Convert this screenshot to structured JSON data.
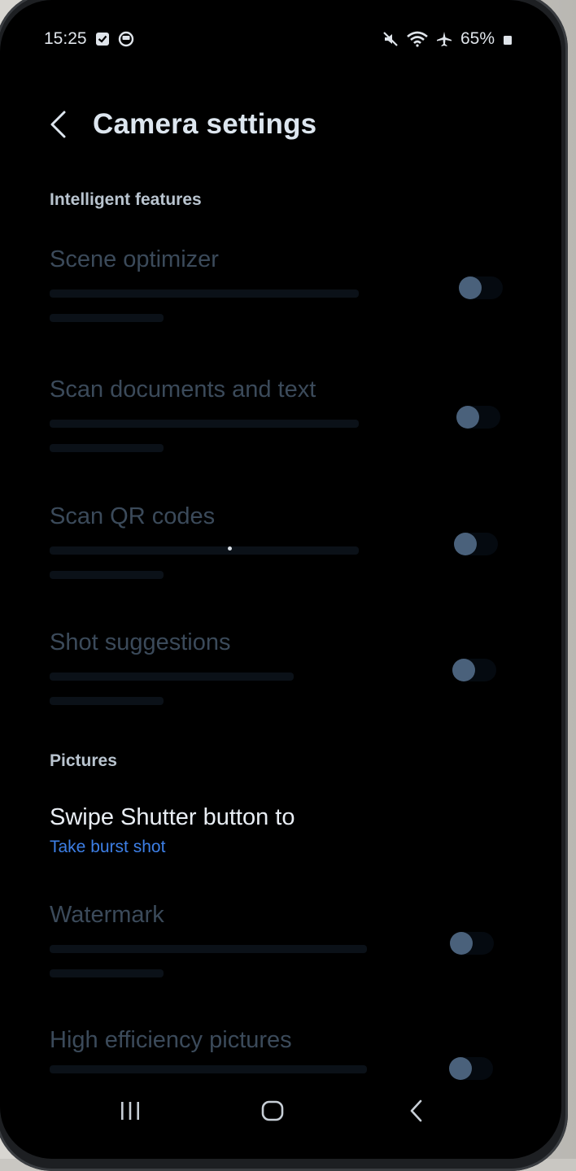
{
  "status_bar": {
    "time": "15:25",
    "battery": "65%"
  },
  "header": {
    "title": "Camera settings"
  },
  "sections": {
    "intelligent": "Intelligent features",
    "pictures": "Pictures"
  },
  "settings": {
    "scene_optimizer": {
      "title": "Scene optimizer",
      "enabled": false
    },
    "scan_documents": {
      "title": "Scan documents and text",
      "enabled": false
    },
    "scan_qr": {
      "title": "Scan QR codes",
      "enabled": false
    },
    "shot_suggestions": {
      "title": "Shot suggestions",
      "enabled": false
    },
    "swipe_shutter": {
      "title": "Swipe Shutter button to",
      "value": "Take burst shot"
    },
    "watermark": {
      "title": "Watermark",
      "enabled": false
    },
    "high_efficiency": {
      "title": "High efficiency pictures",
      "enabled": false
    }
  },
  "colors": {
    "accent": "#3d7fe6",
    "toggle_knob": "#4a617b",
    "background": "#000000"
  },
  "icons": {
    "back": "chevron-left-icon",
    "recents": "recents-icon",
    "home": "home-icon",
    "nav_back": "nav-back-icon"
  }
}
